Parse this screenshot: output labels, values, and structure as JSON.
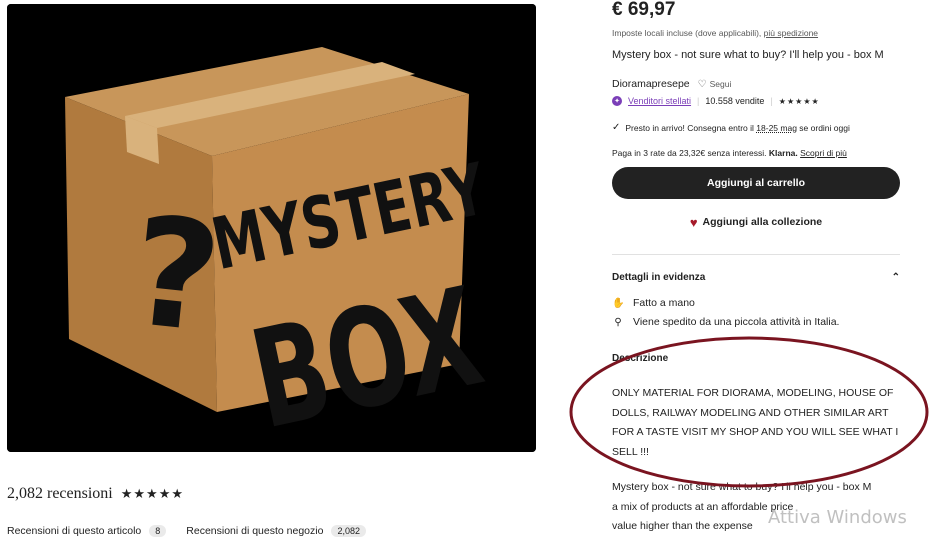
{
  "image": {
    "box_text_line1": "MYSTERY",
    "box_text_line2": "BOX",
    "box_symbol": "?"
  },
  "reviews": {
    "count_text": "2,082 recensioni",
    "stars": "★★★★★",
    "tab_item_label": "Recensioni di questo articolo",
    "tab_item_count": "8",
    "tab_shop_label": "Recensioni di questo negozio",
    "tab_shop_count": "2,082"
  },
  "listing": {
    "price": "€ 69,97",
    "tax_text": "Imposte locali incluse (dove applicabili),",
    "shipping_link": "più spedizione",
    "title": "Mystery box - not sure what to buy? I'll help you - box M"
  },
  "shop": {
    "name": "Dioramapresepe",
    "follow_label": "Segui",
    "star_seller_label": "Venditori stellati",
    "sales": "10.558 vendite",
    "rating_stars": "★★★★★"
  },
  "delivery": {
    "prefix": "Presto in arrivo! Consegna entro il",
    "dates": "18-25 mag",
    "suffix": "se ordini oggi"
  },
  "klarna": {
    "prefix": "Paga in 3 rate da 23,32€ senza interessi.",
    "brand": "Klarna.",
    "link": "Scopri di più"
  },
  "actions": {
    "add_to_cart": "Aggiungi al carrello",
    "add_to_collection": "Aggiungi alla collezione"
  },
  "highlights": {
    "heading": "Dettagli in evidenza",
    "handmade": "Fatto a mano",
    "shipping_prefix": "Viene spedito da una piccola attività in",
    "shipping_country": "Italia."
  },
  "description": {
    "heading": "Descrizione",
    "line1": "ONLY MATERIAL FOR DIORAMA, MODELING, HOUSE OF",
    "line2": "DOLLS, RAILWAY MODELING AND OTHER SIMILAR ART",
    "line3": "FOR A TASTE VISIT MY SHOP AND YOU WILL SEE WHAT I",
    "line4": "SELL !!!",
    "line5": "Mystery box - not sure what to buy? I'll help you - box M",
    "line6": "a mix of products at an affordable price",
    "line7": "value higher than the expense"
  },
  "overlay": {
    "watermark": "Attiva Windows"
  },
  "colors": {
    "cart_button": "#222222",
    "star_seller": "#7b3fb8",
    "heart": "#a61a2a",
    "annotation_ellipse": "#7a1420"
  }
}
